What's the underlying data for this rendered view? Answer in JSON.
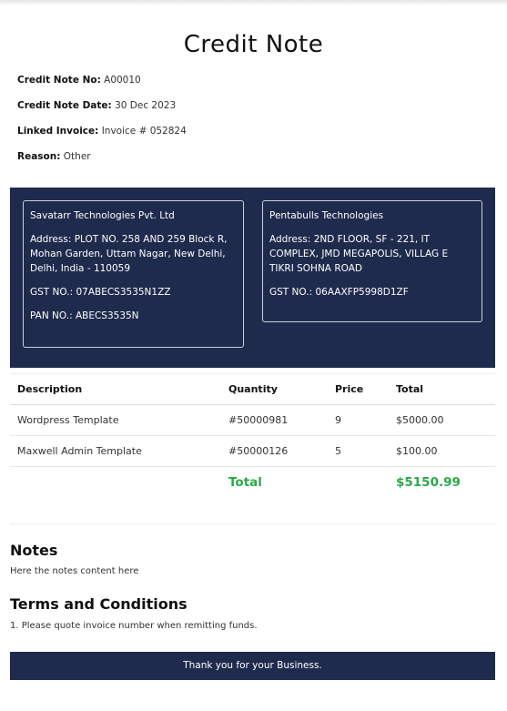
{
  "title": "Credit Note",
  "meta": {
    "credit_note_no_label": "Credit Note No:",
    "credit_note_no": "A00010",
    "date_label": "Credit Note Date:",
    "date": "30 Dec 2023",
    "linked_invoice_label": "Linked Invoice:",
    "linked_invoice": "Invoice # 052824",
    "reason_label": "Reason:",
    "reason": "Other"
  },
  "from": {
    "name": "Savatarr Technologies Pvt. Ltd",
    "address": "Address: PLOT NO. 258 AND 259 Block R, Mohan Garden, Uttam Nagar, New Delhi, Delhi, India - 110059",
    "gst": "GST NO.: 07ABECS3535N1ZZ",
    "pan": "PAN NO.: ABECS3535N"
  },
  "to": {
    "name": "Pentabulls Technologies",
    "address": "Address: 2ND FLOOR, SF - 221, IT COMPLEX, JMD MEGAPOLIS, VILLAG E TIKRI SOHNA ROAD",
    "gst": "GST NO.: 06AAXFP5998D1ZF"
  },
  "table": {
    "headers": [
      "Description",
      "Quantity",
      "Price",
      "Total"
    ],
    "rows": [
      [
        "Wordpress Template",
        "#50000981",
        "9",
        "$5000.00"
      ],
      [
        "Maxwell Admin Template",
        "#50000126",
        "5",
        "$100.00"
      ]
    ],
    "total_label": "Total",
    "total_value": "$5150.99"
  },
  "notes": {
    "title": "Notes",
    "text": "Here the notes content here"
  },
  "terms": {
    "title": "Terms and Conditions",
    "text": "1. Please quote invoice number when remitting funds."
  },
  "footer": "Thank you for your Business.",
  "colors": {
    "header_bg": "#1f2b4d",
    "total_green": "#2aa84a"
  }
}
